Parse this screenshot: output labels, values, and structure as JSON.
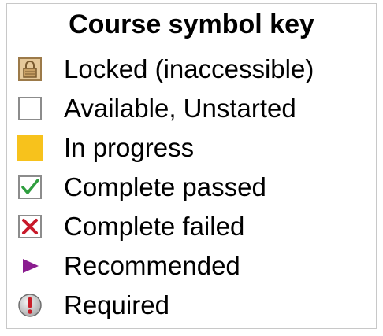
{
  "legend": {
    "title": "Course symbol key",
    "items": [
      {
        "icon": "lock-icon",
        "label": "Locked (inaccessible)"
      },
      {
        "icon": "empty-box-icon",
        "label": "Available, Unstarted"
      },
      {
        "icon": "filled-yellow-box-icon",
        "label": "In progress"
      },
      {
        "icon": "checkmark-icon",
        "label": "Complete passed"
      },
      {
        "icon": "cross-icon",
        "label": "Complete failed"
      },
      {
        "icon": "play-triangle-icon",
        "label": "Recommended"
      },
      {
        "icon": "exclamation-icon",
        "label": "Required"
      }
    ]
  },
  "colors": {
    "lock": "#c8a065",
    "in_progress": "#f7c21c",
    "check": "#2f9e3f",
    "cross": "#c8192a",
    "recommended": "#8a1c8f",
    "required": "#c81e28"
  }
}
